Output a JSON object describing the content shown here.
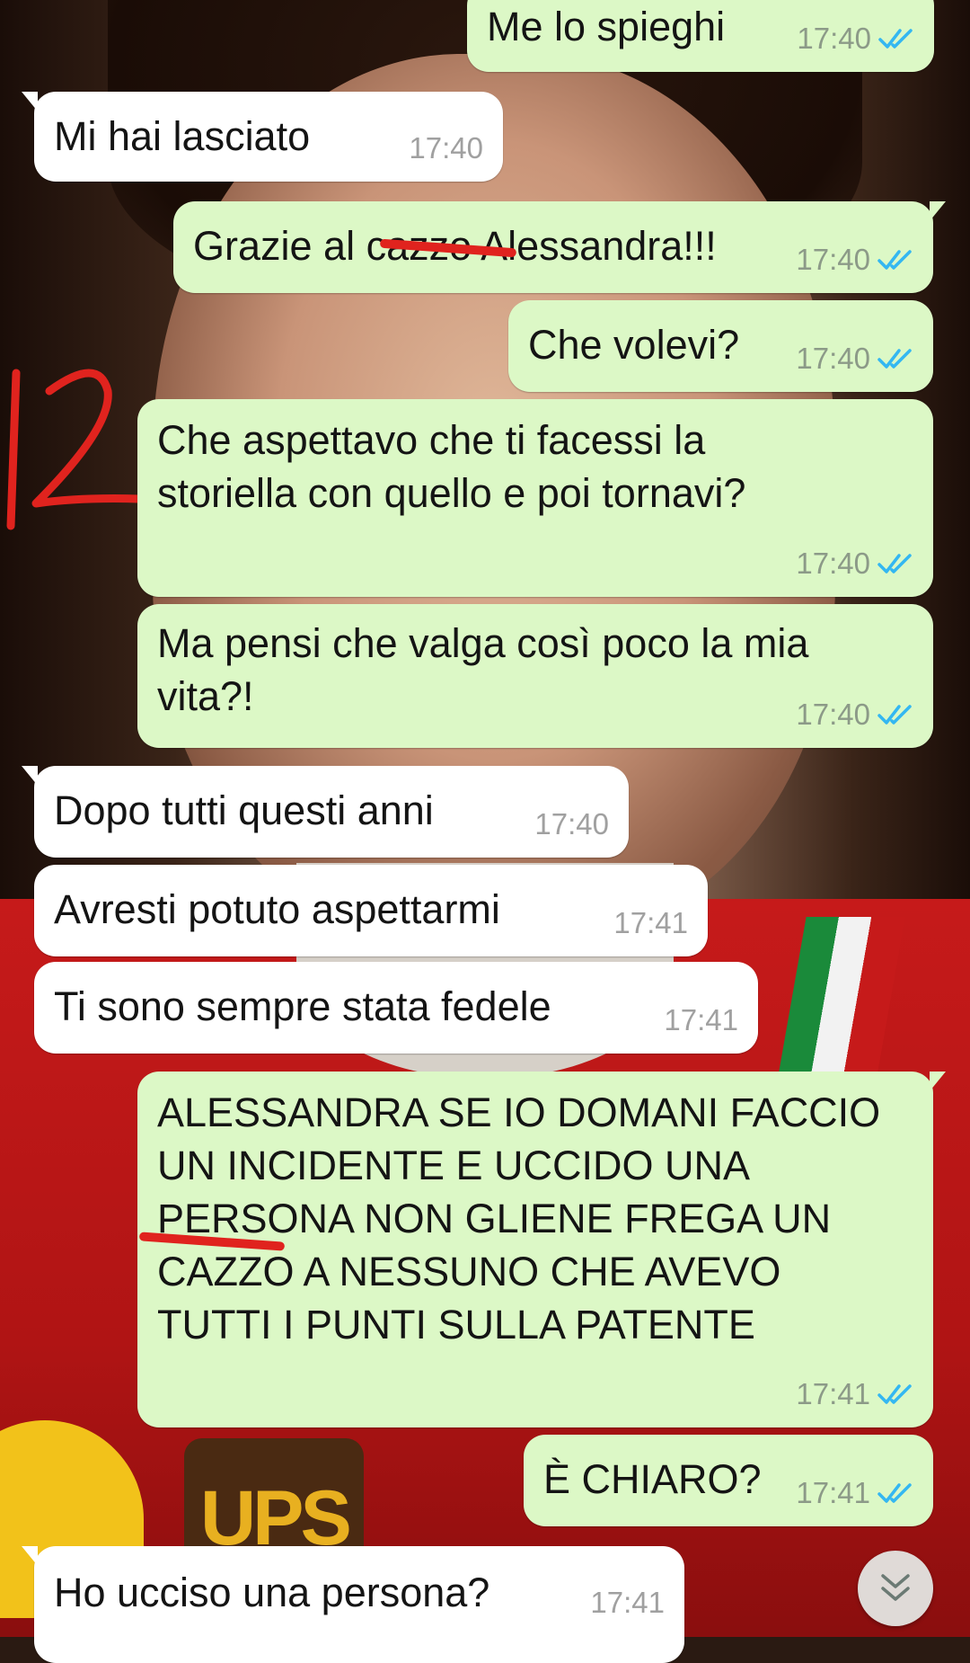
{
  "chat": {
    "messages": [
      {
        "dir": "out",
        "text": "Me lo spieghi",
        "time": "17:40",
        "read": true
      },
      {
        "dir": "in",
        "text": "Mi hai lasciato",
        "time": "17:40"
      },
      {
        "dir": "out",
        "text": "Grazie al cazzo Alessandra!!!",
        "time": "17:40",
        "read": true
      },
      {
        "dir": "out",
        "text": "Che volevi?",
        "time": "17:40",
        "read": true
      },
      {
        "dir": "out",
        "text": "Che aspettavo che ti facessi la\nstoriella con quello e poi tornavi?",
        "time": "17:40",
        "read": true
      },
      {
        "dir": "out",
        "text": "Ma pensi che valga così poco la mia\nvita?!",
        "time": "17:40",
        "read": true
      },
      {
        "dir": "in",
        "text": "Dopo tutti questi anni",
        "time": "17:40"
      },
      {
        "dir": "in",
        "text": "Avresti potuto aspettarmi",
        "time": "17:41"
      },
      {
        "dir": "in",
        "text": "Ti sono sempre stata fedele",
        "time": "17:41"
      },
      {
        "dir": "out",
        "text": "ALESSANDRA SE IO DOMANI FACCIO\nUN INCIDENTE E UCCIDO UNA\nPERSONA NON GLIENE FREGA UN\nCAZZO A NESSUNO CHE AVEVO\nTUTTI I PUNTI SULLA PATENTE",
        "time": "17:41",
        "read": true
      },
      {
        "dir": "out",
        "text": "È CHIARO?",
        "time": "17:41",
        "read": true
      },
      {
        "dir": "in",
        "text": "Ho ucciso una persona?",
        "time": "17:41"
      }
    ]
  },
  "wallpaper": {
    "logo_text": "UPS"
  },
  "colors": {
    "outgoing": "#dcf8c6",
    "incoming": "#ffffff",
    "read_tick": "#34b7f1",
    "annotation": "#e0231e"
  },
  "icons": {
    "read_receipt": "double-check-icon",
    "scroll": "chevron-double-down-icon"
  }
}
